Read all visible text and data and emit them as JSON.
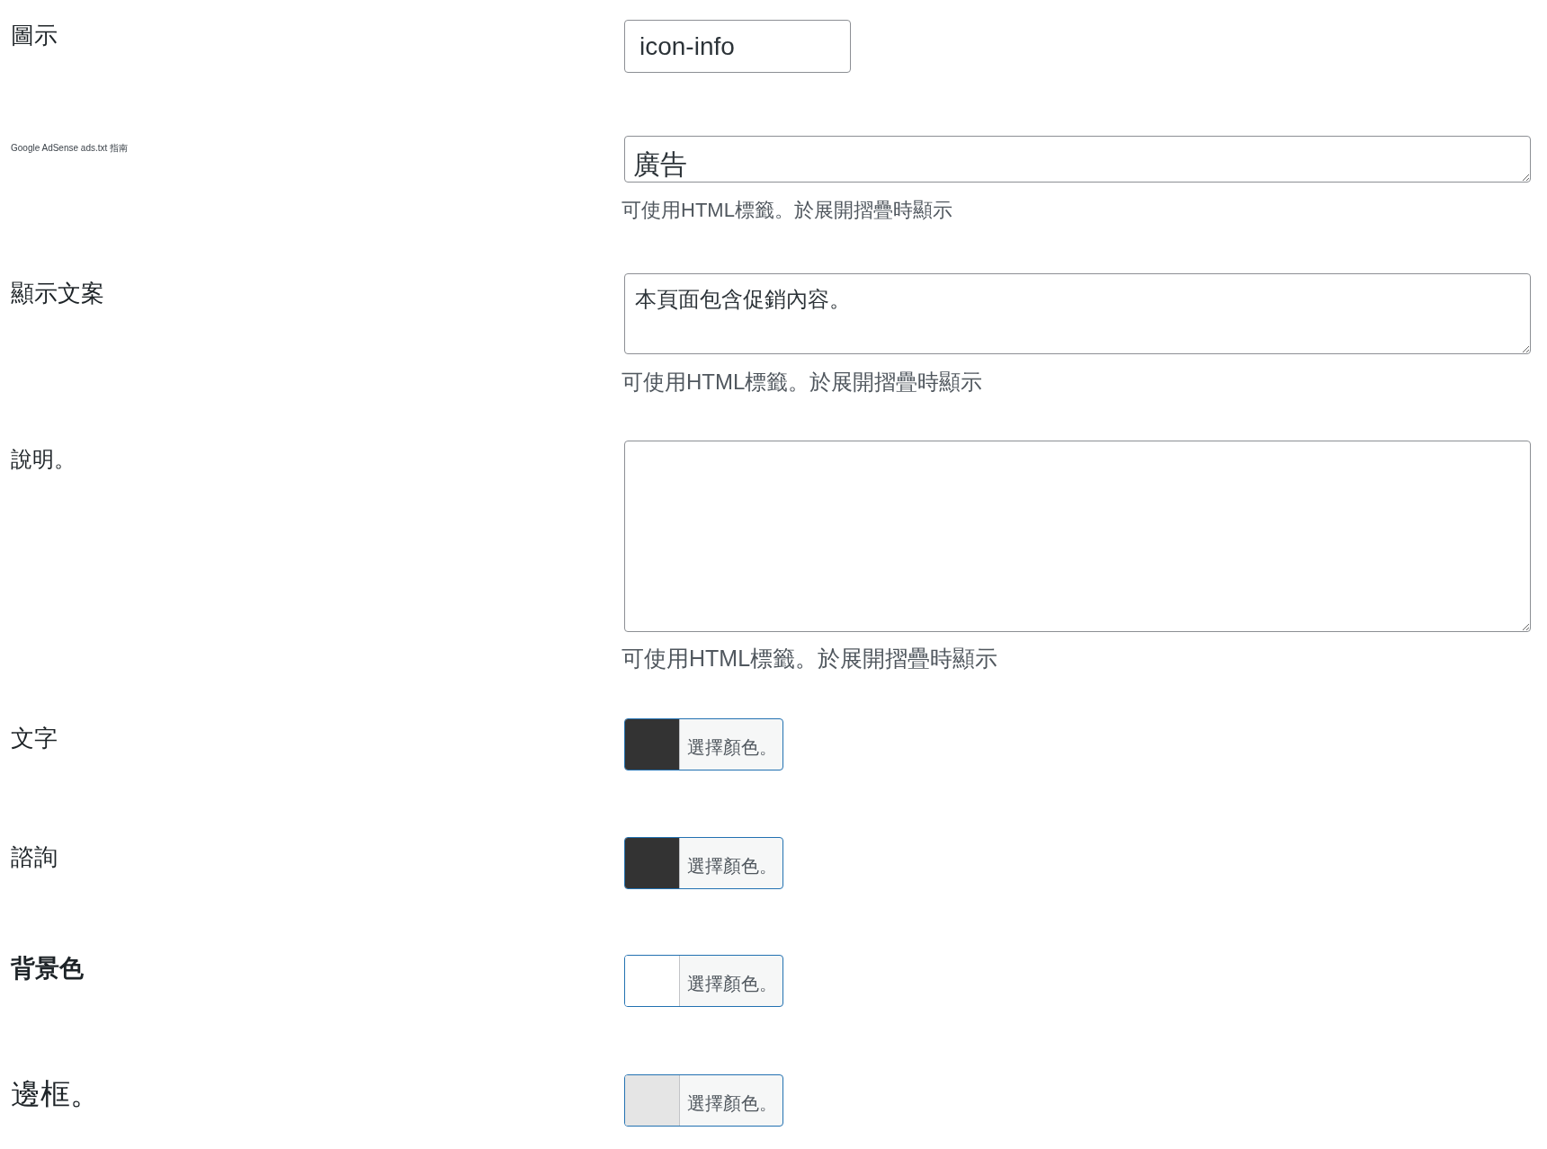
{
  "rows": [
    {
      "kind": "text",
      "label": "圖示",
      "value": "icon-info"
    },
    {
      "kind": "textarea",
      "label": "Google AdSense ads.txt 指南",
      "value": "廣告",
      "help": "可使用HTML標籤。於展開摺疊時顯示"
    },
    {
      "kind": "textarea",
      "label": "顯示文案",
      "value": "本頁面包含促銷內容。",
      "help": "可使用HTML標籤。於展開摺疊時顯示"
    },
    {
      "kind": "textarea",
      "label": "說明。",
      "help": "可使用HTML標籤。於展開摺疊時顯示"
    },
    {
      "kind": "color",
      "label": "文字",
      "color": "#333333",
      "button": "選擇顏色。"
    },
    {
      "kind": "color",
      "label": "諮詢",
      "color": "#333333",
      "button": "選擇顏色。"
    },
    {
      "kind": "color",
      "label": "背景色",
      "color": "#ffffff",
      "button": "選擇顏色。"
    },
    {
      "kind": "color",
      "label": "邊框。",
      "color": "#e5e5e5",
      "button": "選擇顏色。"
    }
  ]
}
